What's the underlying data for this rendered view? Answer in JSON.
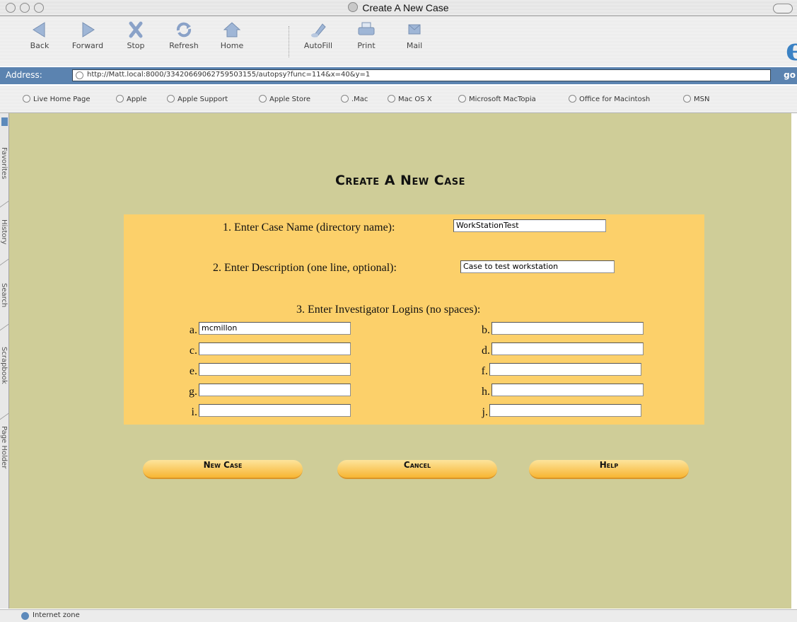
{
  "window": {
    "title": "Create A New Case"
  },
  "toolbar": {
    "buttons": [
      {
        "label": "Back",
        "icon": "back-arrow-icon"
      },
      {
        "label": "Forward",
        "icon": "forward-arrow-icon"
      },
      {
        "label": "Stop",
        "icon": "stop-icon"
      },
      {
        "label": "Refresh",
        "icon": "refresh-icon"
      },
      {
        "label": "Home",
        "icon": "home-icon"
      },
      {
        "label": "AutoFill",
        "icon": "autofill-icon"
      },
      {
        "label": "Print",
        "icon": "print-icon"
      },
      {
        "label": "Mail",
        "icon": "mail-icon"
      }
    ]
  },
  "address": {
    "label": "Address:",
    "url": "http://Matt.local:8000/33420669062759503155/autopsy?func=114&x=40&y=1",
    "go": "go"
  },
  "favorites": [
    "Live Home Page",
    "Apple",
    "Apple Support",
    "Apple Store",
    ".Mac",
    "Mac OS X",
    "Microsoft MacTopia",
    "Office for Macintosh",
    "MSN"
  ],
  "sidebar": {
    "tabs": [
      "Favorites",
      "History",
      "Search",
      "Scrapbook",
      "Page Holder"
    ]
  },
  "page": {
    "title": "Create A New Case",
    "case_name_label": "1. Enter Case Name (directory name):",
    "case_name_value": "WorkStationTest",
    "description_label": "2. Enter Description (one line, optional):",
    "description_value": "Case to test workstation",
    "logins_label": "3. Enter Investigator Logins (no spaces):",
    "logins": [
      {
        "label": "a.",
        "value": "mcmillon"
      },
      {
        "label": "b.",
        "value": ""
      },
      {
        "label": "c.",
        "value": ""
      },
      {
        "label": "d.",
        "value": ""
      },
      {
        "label": "e.",
        "value": ""
      },
      {
        "label": "f.",
        "value": ""
      },
      {
        "label": "g.",
        "value": ""
      },
      {
        "label": "h.",
        "value": ""
      },
      {
        "label": "i.",
        "value": ""
      },
      {
        "label": "j.",
        "value": ""
      }
    ],
    "buttons": {
      "new_case": "New Case",
      "cancel": "Cancel",
      "help": "Help"
    }
  },
  "status": {
    "text": "Internet zone"
  }
}
